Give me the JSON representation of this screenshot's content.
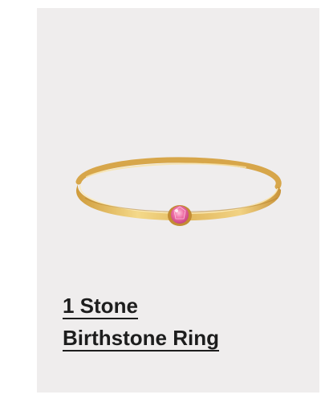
{
  "product": {
    "title_line1": "1 Stone",
    "title_line2": "Birthstone Ring",
    "image_icon": "gold-ring-with-pink-stone",
    "colors": {
      "card_background": "#efeded",
      "gold": "#d9ad4f",
      "stone": "#e86aa0",
      "text": "#1d1d1d"
    }
  }
}
